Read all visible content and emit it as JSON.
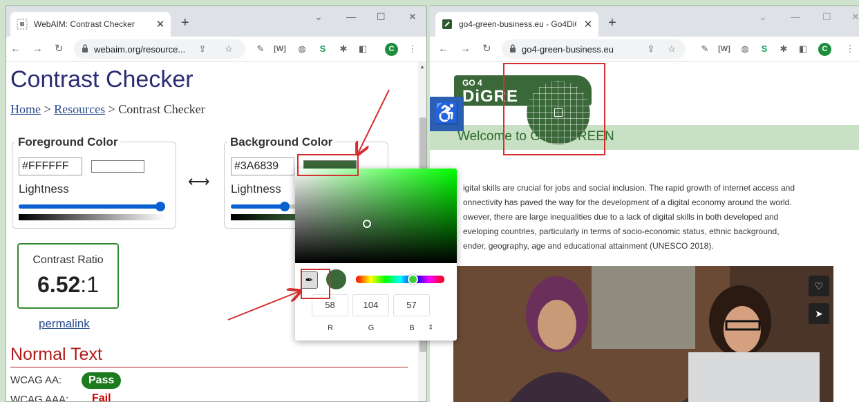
{
  "left_window": {
    "tab_title": "WebAIM: Contrast Checker",
    "url": "webaim.org/resource...",
    "page_title": "Contrast Checker",
    "breadcrumb": {
      "home": "Home",
      "sep": ">",
      "resources": "Resources",
      "current": "Contrast Checker"
    },
    "foreground": {
      "legend": "Foreground Color",
      "hex": "#FFFFFF",
      "swatch_color": "#FFFFFF",
      "lightness_label": "Lightness",
      "lightness": 1.0
    },
    "background": {
      "legend": "Background Color",
      "hex": "#3A6839",
      "swatch_color": "#3A6839",
      "lightness_label": "Lightness",
      "lightness": 0.36
    },
    "swap_symbol": "⟷",
    "contrast": {
      "label": "Contrast Ratio",
      "ratio": "6.52",
      "suffix": ":1"
    },
    "permalink": "permalink",
    "normal_text": {
      "heading": "Normal Text",
      "aa_label": "WCAG AA:",
      "aa_result": "Pass",
      "aaa_label": "WCAG AAA:",
      "aaa_result": "Fail"
    },
    "avatar_letter": "C"
  },
  "color_picker": {
    "r": "58",
    "g": "104",
    "b": "57",
    "r_label": "R",
    "g_label": "G",
    "b_label": "B",
    "current_color": "#3A6839",
    "hue": 0.66
  },
  "right_window": {
    "tab_title": "go4-green-business.eu - Go4DiG",
    "url": "go4-green-business.eu",
    "logo_top": "GO 4",
    "logo_main": "DiGRE",
    "welcome": "Welcome to Go4DiGREEN",
    "paragraph": [
      "igital skills are crucial for jobs and social inclusion. The rapid growth of internet access and",
      "onnectivity has paved the way for the development of a digital economy around the world.",
      "owever, there are large inequalities due to a lack of digital skills in both developed and",
      "eveloping countries, particularly in terms of socio-economic status, ethnic background,",
      "ender, geography, age and educational attainment (UNESCO 2018)."
    ],
    "avatar_letter": "C"
  },
  "colors": {
    "brand_green": "#3A6839",
    "accent_blue": "#0A60D0",
    "pass_green": "#1D7A1D",
    "fail_red": "#CC0000",
    "annotation_red": "#D32F2F"
  }
}
